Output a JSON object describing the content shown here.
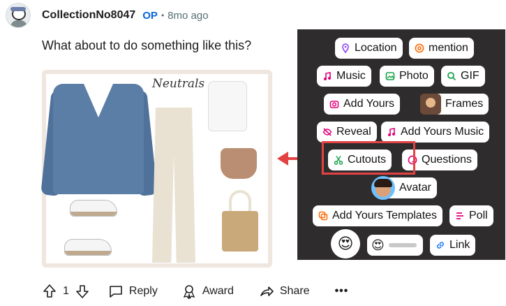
{
  "comment": {
    "author": "CollectionNo8047",
    "op_badge": "OP",
    "separator": "•",
    "age": "8mo ago",
    "text": "What about to do something like this?"
  },
  "outfit_image": {
    "label": "Neutrals"
  },
  "stickers": {
    "items": [
      {
        "label": "Location",
        "icon": "location-pin-icon",
        "color": "#8a3ffc"
      },
      {
        "label": "mention",
        "icon": "at-sign-icon",
        "color": "#ff6a00"
      },
      {
        "label": "Music",
        "icon": "music-note-icon",
        "color": "#e1007a"
      },
      {
        "label": "Photo",
        "icon": "image-icon",
        "color": "#17a34a"
      },
      {
        "label": "GIF",
        "icon": "search-icon",
        "color": "#17a34a"
      },
      {
        "label": "Add Yours",
        "icon": "camera-icon",
        "color": "#e1007a"
      },
      {
        "label": "Frames",
        "icon": "photo-thumbnail-icon",
        "color": "#6b4a3a"
      },
      {
        "label": "Reveal",
        "icon": "eye-off-icon",
        "color": "#e1007a"
      },
      {
        "label": "Add Yours Music",
        "icon": "music-note-icon",
        "color": "#e1007a"
      },
      {
        "label": "Cutouts",
        "icon": "scissors-icon",
        "color": "#17a34a"
      },
      {
        "label": "Questions",
        "icon": "question-icon",
        "color": "#e1007a"
      },
      {
        "label": "Avatar",
        "icon": "avatar-icon",
        "color": "#6ec1ff"
      },
      {
        "label": "Add Yours Templates",
        "icon": "template-icon",
        "color": "#ff6a00"
      },
      {
        "label": "Poll",
        "icon": "poll-icon",
        "color": "#e1007a"
      },
      {
        "label": "Link",
        "icon": "link-icon",
        "color": "#1d7cf2"
      }
    ],
    "emoji": "😍",
    "slider_emoji": "😍"
  },
  "actions": {
    "vote_count": "1",
    "reply": "Reply",
    "award": "Award",
    "share": "Share",
    "more": "•••"
  }
}
